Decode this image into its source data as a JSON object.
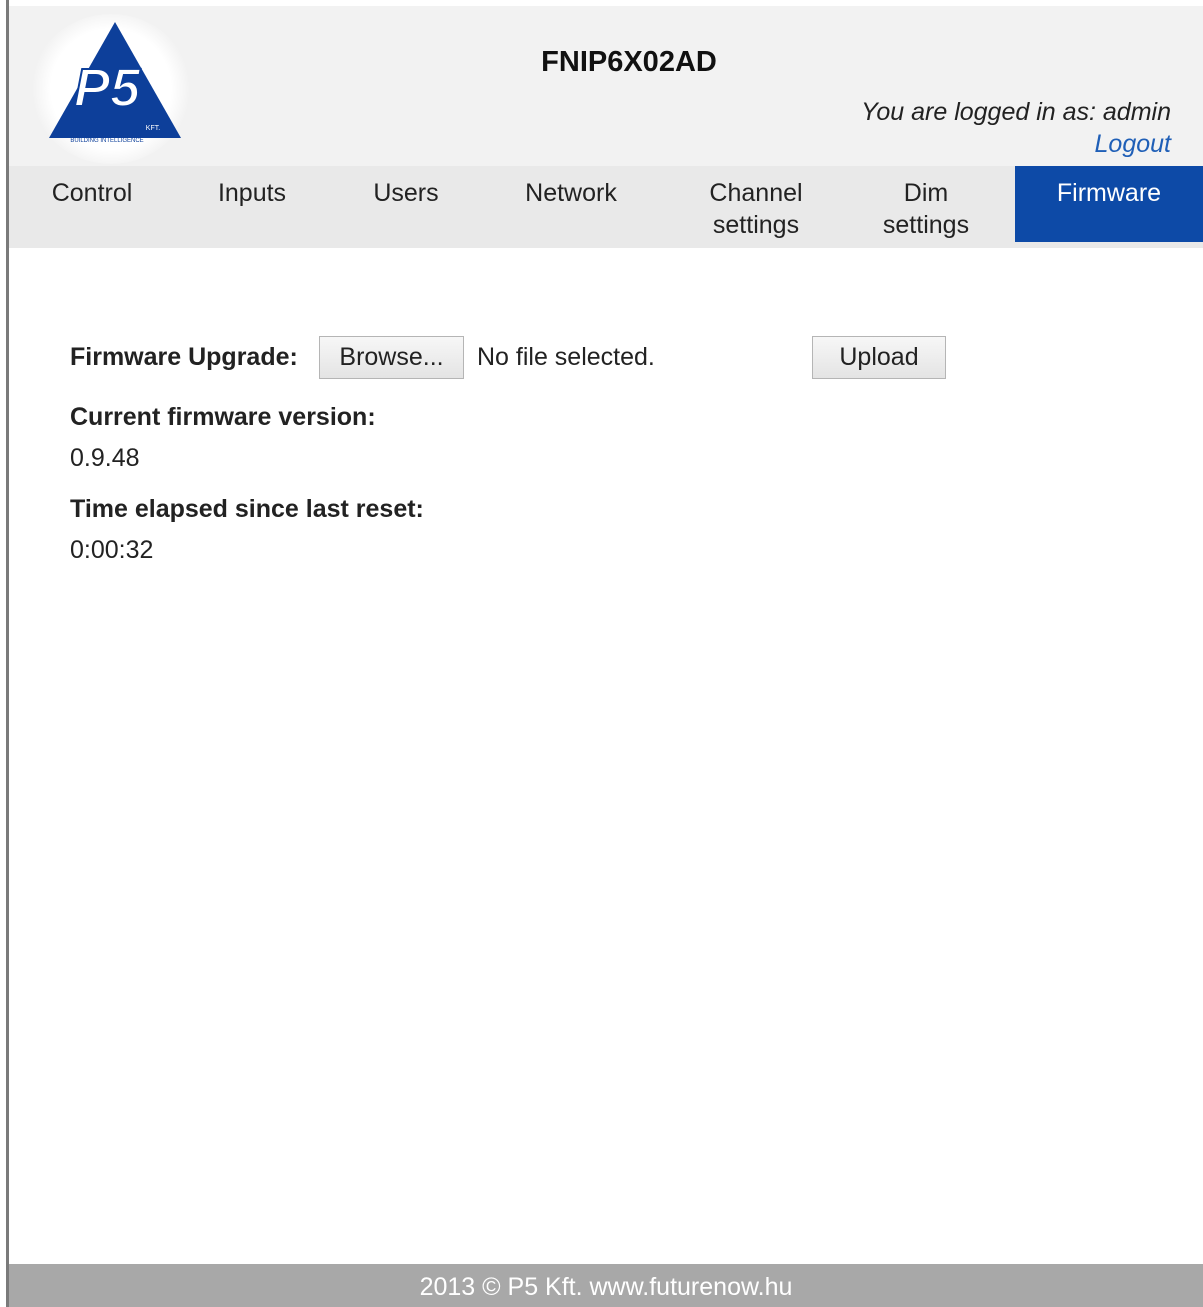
{
  "header": {
    "device_name": "FNIP6X02AD",
    "login_text": "You are logged in as: admin",
    "logout_label": "Logout",
    "logo_text": "P5",
    "logo_sub": "KFT.",
    "logo_tagline": "BUILDING INTELLIGENCE"
  },
  "nav": {
    "items": [
      {
        "label": "Control"
      },
      {
        "label": "Inputs"
      },
      {
        "label": "Users"
      },
      {
        "label": "Network"
      },
      {
        "label": "Channel\nsettings"
      },
      {
        "label": "Dim\nsettings"
      },
      {
        "label": "Firmware"
      }
    ],
    "active": "Firmware",
    "active_color": "#0d4aa7"
  },
  "firmware": {
    "upgrade_label": "Firmware Upgrade:",
    "browse_label": "Browse...",
    "file_status": "No file selected.",
    "upload_label": "Upload",
    "version_label": "Current firmware version:",
    "version_value": "0.9.48",
    "uptime_label": "Time elapsed since last reset:",
    "uptime_value": "0:00:32"
  },
  "footer": {
    "text": "2013 © P5 Kft.  www.futurenow.hu"
  }
}
